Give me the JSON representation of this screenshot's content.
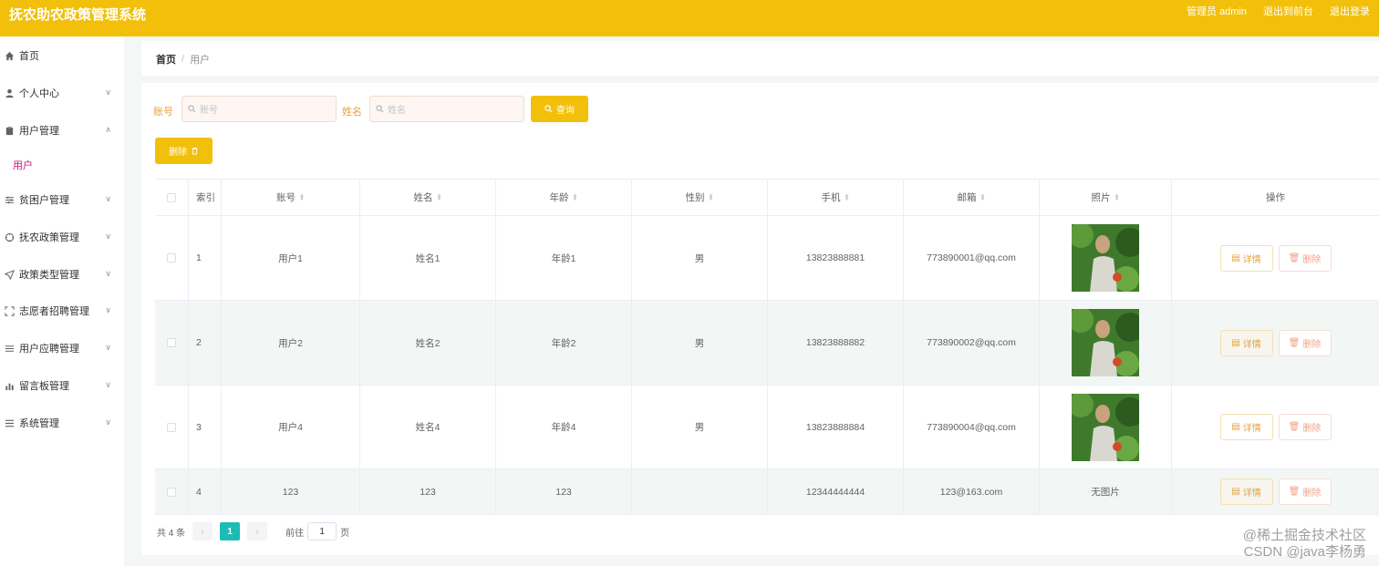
{
  "header": {
    "title": "抚农助农政策管理系统",
    "admin_label": "管理员 admin",
    "back_frontend": "退出到前台",
    "logout": "退出登录"
  },
  "sidebar": {
    "items": [
      {
        "label": "首页",
        "icon": "home-icon"
      },
      {
        "label": "个人中心",
        "icon": "user-icon"
      },
      {
        "label": "用户管理",
        "icon": "clipboard-icon"
      },
      {
        "label": "贫困户管理",
        "icon": "sliders-icon"
      },
      {
        "label": "抚农政策管理",
        "icon": "compass-icon"
      },
      {
        "label": "政策类型管理",
        "icon": "send-icon"
      },
      {
        "label": "志愿者招聘管理",
        "icon": "fullscreen-icon"
      },
      {
        "label": "用户应聘管理",
        "icon": "menu-icon"
      },
      {
        "label": "留言板管理",
        "icon": "bar-chart-icon"
      },
      {
        "label": "系统管理",
        "icon": "list-icon"
      }
    ],
    "sub_item": "用户"
  },
  "breadcrumb": {
    "home": "首页",
    "sep": "/",
    "current": "用户"
  },
  "search": {
    "account_label": "账号",
    "account_placeholder": "账号",
    "name_label": "姓名",
    "name_placeholder": "姓名",
    "query_button": "查询",
    "delete_button": "删除"
  },
  "table": {
    "headers": [
      "索引",
      "账号",
      "姓名",
      "年龄",
      "性别",
      "手机",
      "邮箱",
      "照片",
      "操作"
    ],
    "rows": [
      {
        "index": "1",
        "account": "用户1",
        "name": "姓名1",
        "age": "年龄1",
        "gender": "男",
        "phone": "13823888881",
        "email": "773890001@qq.com",
        "photo": "image"
      },
      {
        "index": "2",
        "account": "用户2",
        "name": "姓名2",
        "age": "年龄2",
        "gender": "男",
        "phone": "13823888882",
        "email": "773890002@qq.com",
        "photo": "image"
      },
      {
        "index": "3",
        "account": "用户4",
        "name": "姓名4",
        "age": "年龄4",
        "gender": "男",
        "phone": "13823888884",
        "email": "773890004@qq.com",
        "photo": "image"
      },
      {
        "index": "4",
        "account": "123",
        "name": "123",
        "age": "123",
        "gender": "",
        "phone": "12344444444",
        "email": "123@163.com",
        "photo": "无图片"
      }
    ],
    "detail_label": "详情",
    "delete_label": "删除"
  },
  "pagination": {
    "total": "共 4 条",
    "current_page": "1",
    "goto_label": "前往",
    "goto_value": "1",
    "page_suffix": "页"
  },
  "watermark": {
    "line1": "@稀土掘金技术社区",
    "line2": "CSDN @java李杨勇"
  },
  "colors": {
    "header": "#f2c00a",
    "accent": "#f2c00a",
    "page_active": "#1cbbb4",
    "submenu": "#c71585"
  }
}
